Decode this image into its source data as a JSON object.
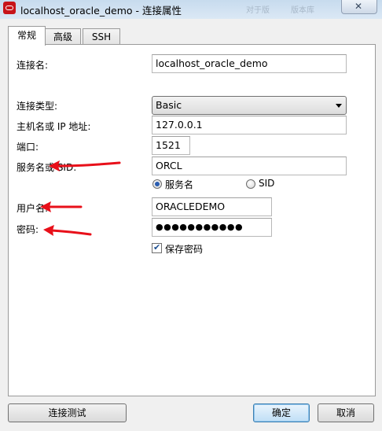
{
  "window": {
    "title": "localhost_oracle_demo - 连接属性",
    "ghost_titles": [
      "对于版",
      "版本库"
    ]
  },
  "tabs": [
    {
      "label": "常规",
      "active": true
    },
    {
      "label": "高级",
      "active": false
    },
    {
      "label": "SSH",
      "active": false
    }
  ],
  "form": {
    "connection_name_label": "连接名:",
    "connection_name_value": "localhost_oracle_demo",
    "connection_type_label": "连接类型:",
    "connection_type_value": "Basic",
    "host_label": "主机名或 IP 地址:",
    "host_value": "127.0.0.1",
    "port_label": "端口:",
    "port_value": "1521",
    "service_label": "服务名或 SID:",
    "service_value": "ORCL",
    "radio_service_label": "服务名",
    "radio_sid_label": "SID",
    "radio_selected": "服务名",
    "username_label": "用户名:",
    "username_value": "ORACLEDEMO",
    "password_label": "密码:",
    "password_value": "●●●●●●●●●●●",
    "save_password_label": "保存密码",
    "save_password_checked": true
  },
  "buttons": {
    "test_connection": "连接测试",
    "ok": "确定",
    "cancel": "取消"
  },
  "colors": {
    "annotation_arrow": "#e8101a",
    "oracle_icon": "#c7141a"
  },
  "icons": {
    "app": "oracle-icon",
    "close": "close-icon",
    "dropdown": "chevron-down-icon",
    "checkbox": "check-mark-icon",
    "annotation": "red-arrow-icon"
  }
}
